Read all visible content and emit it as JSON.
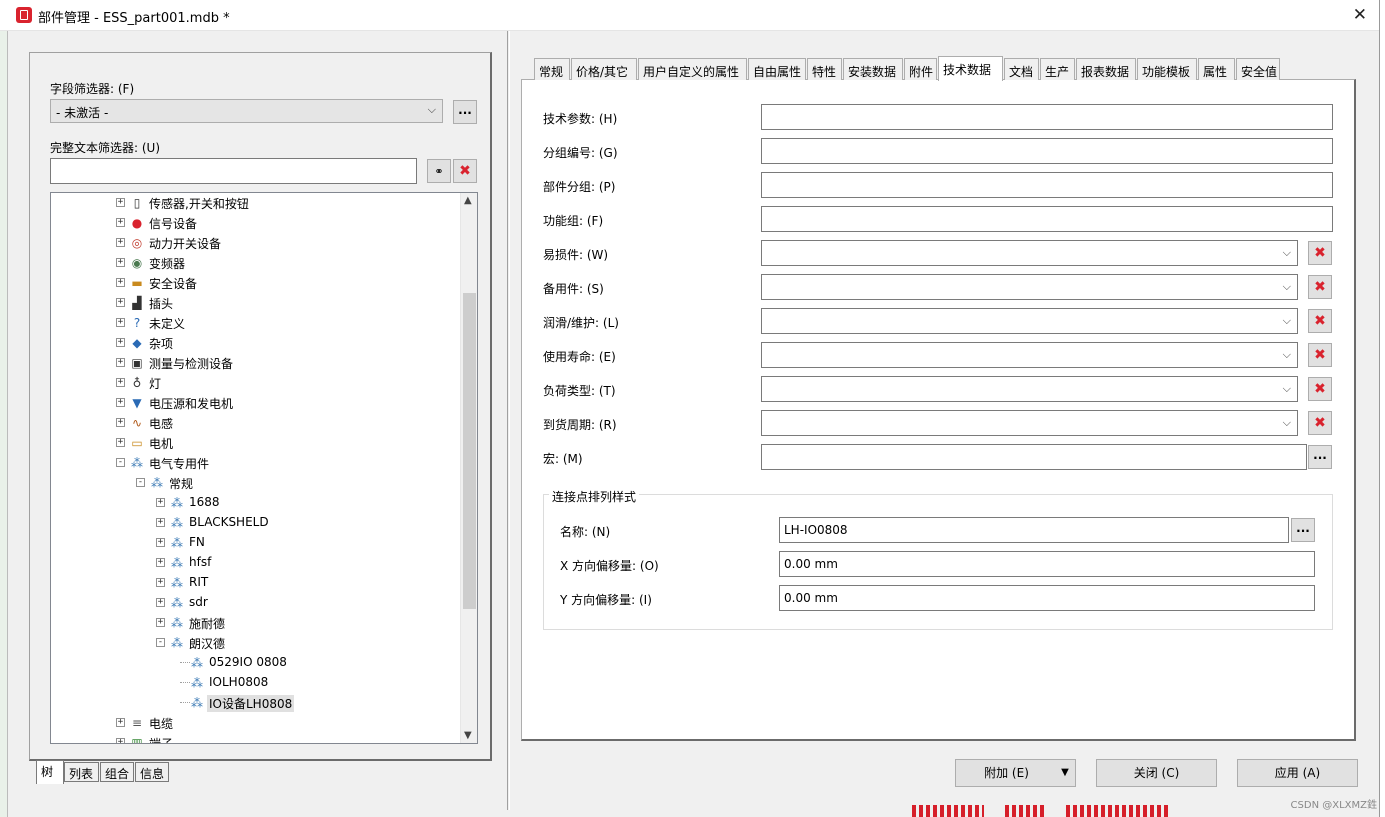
{
  "window": {
    "title": "部件管理 - ESS_part001.mdb *"
  },
  "left": {
    "field_filter_label": "字段筛选器: (F)",
    "field_filter_value": "- 未激活 -",
    "fulltext_filter_label": "完整文本筛选器: (U)",
    "fulltext_filter_value": "",
    "tree": [
      {
        "label": "传感器,开关和按钮",
        "icon": "sensor-icon",
        "glyph": "▯"
      },
      {
        "label": "信号设备",
        "icon": "signal-icon",
        "glyph": "●"
      },
      {
        "label": "动力开关设备",
        "icon": "power-switch-icon",
        "glyph": "◎"
      },
      {
        "label": "变频器",
        "icon": "inverter-icon",
        "glyph": "◉"
      },
      {
        "label": "安全设备",
        "icon": "safety-icon",
        "glyph": "▬"
      },
      {
        "label": "插头",
        "icon": "plug-icon",
        "glyph": "▟"
      },
      {
        "label": "未定义",
        "icon": "question-icon",
        "glyph": "?"
      },
      {
        "label": "杂项",
        "icon": "misc-icon",
        "glyph": "◆"
      },
      {
        "label": "测量与检测设备",
        "icon": "measure-icon",
        "glyph": "▣"
      },
      {
        "label": "灯",
        "icon": "lamp-icon",
        "glyph": "♁"
      },
      {
        "label": "电压源和发电机",
        "icon": "voltage-source-icon",
        "glyph": "▼"
      },
      {
        "label": "电感",
        "icon": "inductor-icon",
        "glyph": "∿"
      },
      {
        "label": "电机",
        "icon": "motor-icon",
        "glyph": "▭"
      },
      {
        "label": "电气专用件",
        "icon": "component-icon",
        "glyph": "⁂"
      },
      {
        "label": "常规",
        "icon": "component-icon",
        "glyph": "⁂"
      },
      {
        "label": "1688",
        "icon": "component-icon",
        "glyph": "⁂"
      },
      {
        "label": "BLACKSHELD",
        "icon": "component-icon",
        "glyph": "⁂"
      },
      {
        "label": "FN",
        "icon": "component-icon",
        "glyph": "⁂"
      },
      {
        "label": "hfsf",
        "icon": "component-icon",
        "glyph": "⁂"
      },
      {
        "label": "RIT",
        "icon": "component-icon",
        "glyph": "⁂"
      },
      {
        "label": "sdr",
        "icon": "component-icon",
        "glyph": "⁂"
      },
      {
        "label": "施耐德",
        "icon": "component-icon",
        "glyph": "⁂"
      },
      {
        "label": "朗汉德",
        "icon": "component-icon",
        "glyph": "⁂"
      },
      {
        "label": "0529IO 0808",
        "icon": "component-icon",
        "glyph": "⁂"
      },
      {
        "label": "IOLH0808",
        "icon": "component-icon",
        "glyph": "⁂"
      },
      {
        "label": "IO设备LH0808",
        "icon": "component-icon",
        "glyph": "⁂"
      },
      {
        "label": "电缆",
        "icon": "cable-icon",
        "glyph": "≡"
      },
      {
        "label": "端子",
        "icon": "terminal-icon",
        "glyph": "▥"
      }
    ],
    "bottom_tabs": [
      "树",
      "列表",
      "组合",
      "信息"
    ]
  },
  "tabs": [
    "常规",
    "价格/其它",
    "用户自定义的属性",
    "自由属性",
    "特性",
    "安装数据",
    "附件",
    "技术数据",
    "文档",
    "生产",
    "报表数据",
    "功能模板",
    "属性",
    "安全值"
  ],
  "active_tab": "技术数据",
  "fields": [
    {
      "label": "技术参数: (H)",
      "value": ""
    },
    {
      "label": "分组编号: (G)",
      "value": ""
    },
    {
      "label": "部件分组: (P)",
      "value": ""
    },
    {
      "label": "功能组: (F)",
      "value": ""
    },
    {
      "label": "易损件: (W)",
      "value": ""
    },
    {
      "label": "备用件: (S)",
      "value": ""
    },
    {
      "label": "润滑/维护: (L)",
      "value": ""
    },
    {
      "label": "使用寿命: (E)",
      "value": ""
    },
    {
      "label": "负荷类型: (T)",
      "value": ""
    },
    {
      "label": "到货周期: (R)",
      "value": ""
    },
    {
      "label": "宏: (M)",
      "value": ""
    }
  ],
  "group": {
    "title": "连接点排列样式",
    "name_label": "名称: (N)",
    "name_value": "LH-IO0808",
    "x_label": "X 方向偏移量: (O)",
    "x_value": "0.00 mm",
    "y_label": "Y 方向偏移量: (I)",
    "y_value": "0.00 mm"
  },
  "buttons": {
    "attach": "附加 (E)",
    "close": "关闭 (C)",
    "apply": "应用 (A)"
  },
  "watermark": "CSDN @XLXMZ鉎"
}
